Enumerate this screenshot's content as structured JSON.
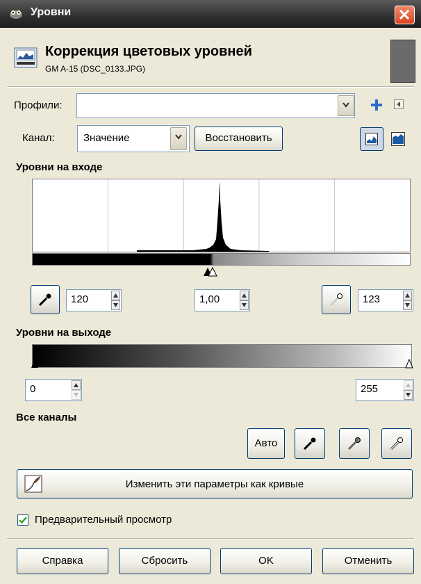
{
  "window": {
    "title": "Уровни"
  },
  "header": {
    "title": "Коррекция цветовых уровней",
    "subtitle": "GM A-15 (DSC_0133.JPG)"
  },
  "profiles": {
    "label": "Профили:",
    "value": ""
  },
  "channel": {
    "label": "Канал:",
    "value": "Значение",
    "reset_label": "Восстановить"
  },
  "input_levels": {
    "title": "Уровни на входе",
    "low": "120",
    "gamma": "1,00",
    "high": "123"
  },
  "output_levels": {
    "title": "Уровни на выходе",
    "low": "0",
    "high": "255"
  },
  "all_channels": {
    "title": "Все каналы",
    "auto_label": "Авто"
  },
  "curves_button": {
    "label": "Изменить эти параметры как кривые"
  },
  "preview": {
    "label": "Предварительный просмотр",
    "checked": true
  },
  "footer": {
    "help": "Справка",
    "reset": "Сбросить",
    "ok": "OK",
    "cancel": "Отменить"
  },
  "colors": {
    "accent": "#003c74",
    "close": "#d9461f",
    "titlebar": "#2f2f2f"
  },
  "icons": {
    "title": "gimp-icon",
    "header": "levels-icon",
    "add": "plus-icon",
    "menu": "menu-arrow-icon",
    "picker": "eyedropper-icon",
    "hist_linear": "linear-histogram-icon",
    "hist_log": "log-histogram-icon",
    "curves": "curves-icon"
  }
}
